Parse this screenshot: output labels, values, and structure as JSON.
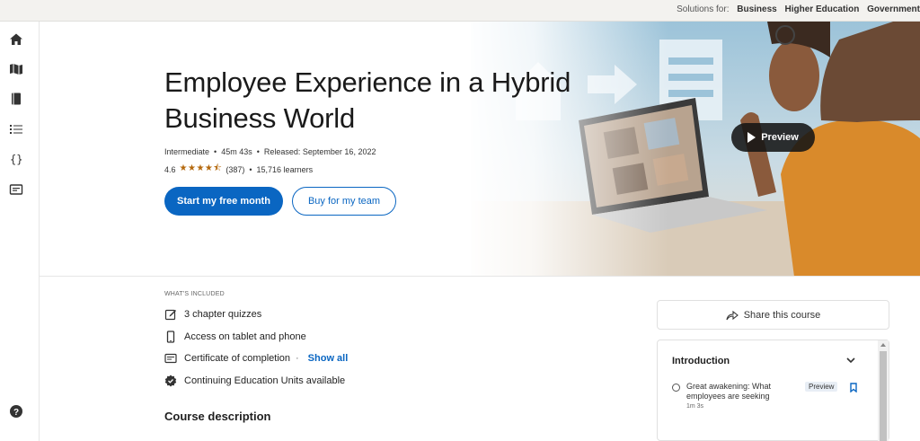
{
  "topbar": {
    "solutions_label": "Solutions for:",
    "links": [
      "Business",
      "Higher Education",
      "Government"
    ]
  },
  "rail": {
    "icons": [
      "home-icon",
      "map-icon",
      "book-icon",
      "list-icon",
      "code-braces-icon",
      "certificate-icon",
      "help-icon"
    ]
  },
  "hero": {
    "title": "Employee Experience in a Hybrid Business World",
    "level": "Intermediate",
    "duration": "45m 43s",
    "released": "Released: September 16, 2022",
    "rating": "4.6",
    "stars": "★★★★⯪",
    "rating_count": "(387)",
    "learners": "15,716 learners",
    "primary_button": "Start my free month",
    "secondary_button": "Buy for my team",
    "preview_button": "Preview"
  },
  "included": {
    "heading": "WHAT'S INCLUDED",
    "items": [
      {
        "icon": "edit-icon",
        "text": "3 chapter quizzes"
      },
      {
        "icon": "phone-icon",
        "text": "Access on tablet and phone"
      },
      {
        "icon": "certificate-icon",
        "text": "Certificate of completion",
        "link": "Show all"
      },
      {
        "icon": "badge-icon",
        "text": "Continuing Education Units available"
      }
    ]
  },
  "course_description_heading": "Course description",
  "sidebar": {
    "share_label": "Share this course",
    "toc": {
      "section": "Introduction",
      "item_title": "Great awakening: What employees are seeking",
      "item_duration": "1m 3s",
      "item_badge": "Preview"
    }
  },
  "colors": {
    "accent": "#0a66c2",
    "star": "#b4690e",
    "topbar_bg": "#f3f2ef"
  }
}
